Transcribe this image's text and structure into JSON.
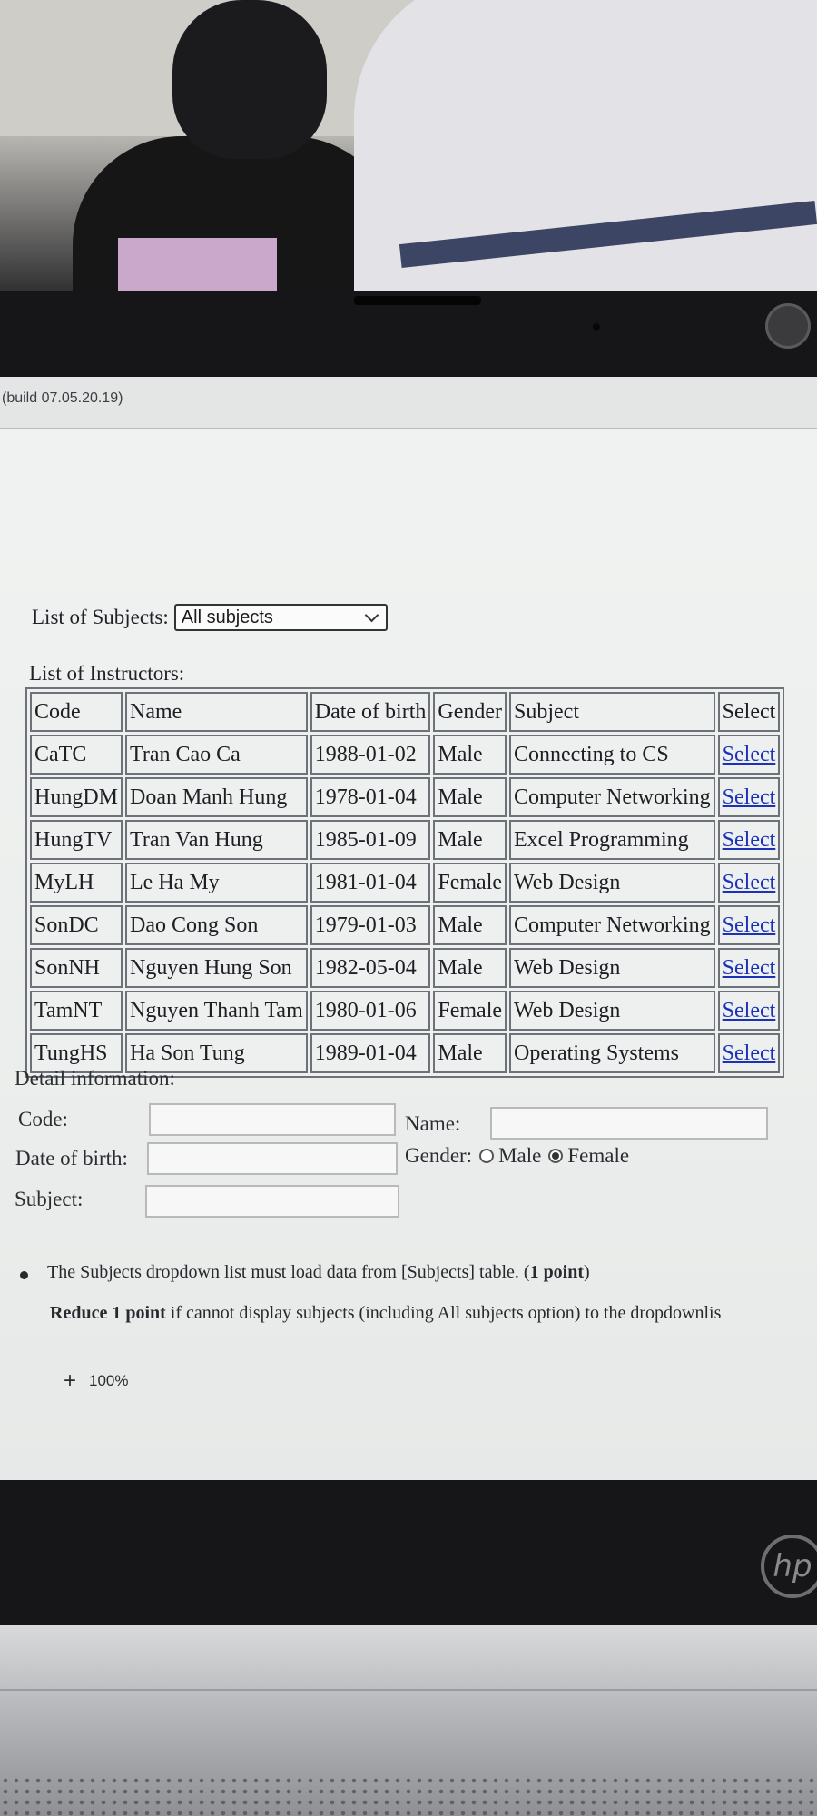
{
  "build": "(build 07.05.20.19)",
  "subjects": {
    "label": "List of Subjects:",
    "selected": "All subjects"
  },
  "instructors": {
    "label": "List of Instructors:",
    "columns": [
      "Code",
      "Name",
      "Date of birth",
      "Gender",
      "Subject",
      "Select"
    ],
    "rows": [
      {
        "code": "CaTC",
        "name": "Tran Cao Ca",
        "dob": "1988-01-02",
        "gender": "Male",
        "subject": "Connecting to CS",
        "select": "Select"
      },
      {
        "code": "HungDM",
        "name": "Doan Manh Hung",
        "dob": "1978-01-04",
        "gender": "Male",
        "subject": "Computer Networking",
        "select": "Select"
      },
      {
        "code": "HungTV",
        "name": "Tran Van Hung",
        "dob": "1985-01-09",
        "gender": "Male",
        "subject": "Excel Programming",
        "select": "Select"
      },
      {
        "code": "MyLH",
        "name": "Le Ha My",
        "dob": "1981-01-04",
        "gender": "Female",
        "subject": "Web Design",
        "select": "Select"
      },
      {
        "code": "SonDC",
        "name": "Dao Cong Son",
        "dob": "1979-01-03",
        "gender": "Male",
        "subject": "Computer Networking",
        "select": "Select"
      },
      {
        "code": "SonNH",
        "name": "Nguyen Hung Son",
        "dob": "1982-05-04",
        "gender": "Male",
        "subject": "Web Design",
        "select": "Select"
      },
      {
        "code": "TamNT",
        "name": "Nguyen Thanh Tam",
        "dob": "1980-01-06",
        "gender": "Female",
        "subject": "Web Design",
        "select": "Select"
      },
      {
        "code": "TungHS",
        "name": "Ha Son Tung",
        "dob": "1989-01-04",
        "gender": "Male",
        "subject": "Operating Systems",
        "select": "Select"
      }
    ]
  },
  "detail": {
    "title": "Detail information:",
    "code_label": "Code:",
    "name_label": "Name:",
    "dob_label": "Date of birth:",
    "gender_label": "Gender:",
    "gender_male": "Male",
    "gender_female": "Female",
    "gender_selected": "Female",
    "subject_label": "Subject:",
    "code_value": "",
    "name_value": "",
    "dob_value": "",
    "subject_value": ""
  },
  "requirements": {
    "line1_pre": "The Subjects dropdown list must load data from [Subjects] table. (",
    "line1_bold": "1 point",
    "line1_post": ")",
    "line2_bold": "Reduce 1 point",
    "line2_post": " if cannot display subjects (including All subjects option) to the dropdownlis"
  },
  "zoom": {
    "plus": "+",
    "value": "100%"
  },
  "brand": "hp"
}
